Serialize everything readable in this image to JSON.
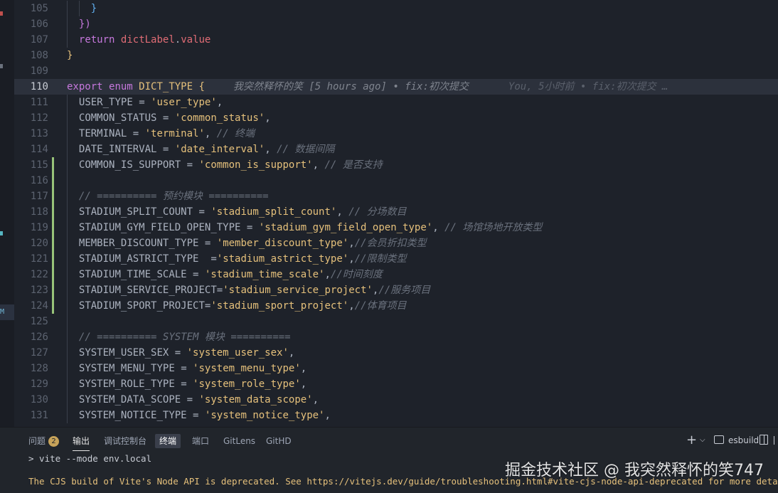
{
  "editor": {
    "lines": [
      {
        "n": "105",
        "indent": 4,
        "tokens": [
          [
            "}",
            "t-br3"
          ]
        ]
      },
      {
        "n": "106",
        "indent": 2,
        "tokens": [
          [
            "})",
            "t-br2"
          ]
        ]
      },
      {
        "n": "107",
        "indent": 2,
        "tokens": [
          [
            "return ",
            "t-kw"
          ],
          [
            "dictLabel",
            "t-prop"
          ],
          [
            ".",
            "t-plain"
          ],
          [
            "value",
            "t-prop"
          ]
        ]
      },
      {
        "n": "108",
        "indent": 0,
        "tokens": [
          [
            "}",
            "t-br1"
          ]
        ]
      },
      {
        "n": "109",
        "indent": 0,
        "tokens": []
      },
      {
        "n": "110",
        "indent": 0,
        "active": true,
        "tokens": [
          [
            "export ",
            "t-kw"
          ],
          [
            "enum ",
            "t-kw"
          ],
          [
            "DICT_TYPE ",
            "t-type"
          ],
          [
            "{",
            "t-br1"
          ]
        ],
        "blame": "我突然释怀的笑 [5 hours ago] • fix:初次提交",
        "blame2": "You, 5小时前 • fix:初次提交 …"
      },
      {
        "n": "111",
        "indent": 2,
        "tokens": [
          [
            "USER_TYPE ",
            "t-plain"
          ],
          [
            "= ",
            "t-plain"
          ],
          [
            "'user_type'",
            "t-str-y"
          ],
          [
            ",",
            "t-plain"
          ]
        ]
      },
      {
        "n": "112",
        "indent": 2,
        "tokens": [
          [
            "COMMON_STATUS ",
            "t-plain"
          ],
          [
            "= ",
            "t-plain"
          ],
          [
            "'common_status'",
            "t-str-y"
          ],
          [
            ",",
            "t-plain"
          ]
        ]
      },
      {
        "n": "113",
        "indent": 2,
        "tokens": [
          [
            "TERMINAL ",
            "t-plain"
          ],
          [
            "= ",
            "t-plain"
          ],
          [
            "'terminal'",
            "t-str-y"
          ],
          [
            ", ",
            "t-plain"
          ],
          [
            "// 终端",
            "t-cm"
          ]
        ]
      },
      {
        "n": "114",
        "indent": 2,
        "tokens": [
          [
            "DATE_INTERVAL ",
            "t-plain"
          ],
          [
            "= ",
            "t-plain"
          ],
          [
            "'date_interval'",
            "t-str-y"
          ],
          [
            ", ",
            "t-plain"
          ],
          [
            "// 数据间隔",
            "t-cm"
          ]
        ]
      },
      {
        "n": "115",
        "indent": 2,
        "mod": true,
        "tokens": [
          [
            "COMMON_IS_SUPPORT ",
            "t-plain"
          ],
          [
            "= ",
            "t-plain"
          ],
          [
            "'common_is_support'",
            "t-str-y"
          ],
          [
            ", ",
            "t-plain"
          ],
          [
            "// 是否支持",
            "t-cm"
          ]
        ]
      },
      {
        "n": "116",
        "indent": 2,
        "mod": true,
        "tokens": []
      },
      {
        "n": "117",
        "indent": 2,
        "mod": true,
        "tokens": [
          [
            "// ========== 预约模块 ==========",
            "t-cm"
          ]
        ]
      },
      {
        "n": "118",
        "indent": 2,
        "mod": true,
        "tokens": [
          [
            "STADIUM_SPLIT_COUNT ",
            "t-plain"
          ],
          [
            "= ",
            "t-plain"
          ],
          [
            "'stadium_split_count'",
            "t-str-y"
          ],
          [
            ", ",
            "t-plain"
          ],
          [
            "// 分场数目",
            "t-cm"
          ]
        ]
      },
      {
        "n": "119",
        "indent": 2,
        "mod": true,
        "tokens": [
          [
            "STADIUM_GYM_FIELD_OPEN_TYPE ",
            "t-plain"
          ],
          [
            "= ",
            "t-plain"
          ],
          [
            "'stadium_gym_field_open_type'",
            "t-str-y"
          ],
          [
            ", ",
            "t-plain"
          ],
          [
            "// 场馆场地开放类型",
            "t-cm"
          ]
        ]
      },
      {
        "n": "120",
        "indent": 2,
        "mod": true,
        "tokens": [
          [
            "MEMBER_DISCOUNT_TYPE ",
            "t-plain"
          ],
          [
            "= ",
            "t-plain"
          ],
          [
            "'member_discount_type'",
            "t-str-y"
          ],
          [
            ",",
            "t-plain"
          ],
          [
            "//会员折扣类型",
            "t-cm"
          ]
        ]
      },
      {
        "n": "121",
        "indent": 2,
        "mod": true,
        "tokens": [
          [
            "STADIUM_ASTRICT_TYPE  ",
            "t-plain"
          ],
          [
            "=",
            "t-plain"
          ],
          [
            "'stadium_astrict_type'",
            "t-str-y"
          ],
          [
            ",",
            "t-plain"
          ],
          [
            "//限制类型",
            "t-cm"
          ]
        ]
      },
      {
        "n": "122",
        "indent": 2,
        "mod": true,
        "tokens": [
          [
            "STADIUM_TIME_SCALE ",
            "t-plain"
          ],
          [
            "= ",
            "t-plain"
          ],
          [
            "'stadium_time_scale'",
            "t-str-y"
          ],
          [
            ",",
            "t-plain"
          ],
          [
            "//时间刻度",
            "t-cm"
          ]
        ]
      },
      {
        "n": "123",
        "indent": 2,
        "mod": true,
        "tokens": [
          [
            "STADIUM_SERVICE_PROJECT",
            "t-plain"
          ],
          [
            "=",
            "t-plain"
          ],
          [
            "'stadium_service_project'",
            "t-str-y"
          ],
          [
            ",",
            "t-plain"
          ],
          [
            "//服务项目",
            "t-cm"
          ]
        ]
      },
      {
        "n": "124",
        "indent": 2,
        "mod": true,
        "tokens": [
          [
            "STADIUM_SPORT_PROJECT",
            "t-plain"
          ],
          [
            "=",
            "t-plain"
          ],
          [
            "'stadium_sport_project'",
            "t-str-y"
          ],
          [
            ",",
            "t-plain"
          ],
          [
            "//体育项目",
            "t-cm"
          ]
        ]
      },
      {
        "n": "125",
        "indent": 2,
        "tokens": []
      },
      {
        "n": "126",
        "indent": 2,
        "tokens": [
          [
            "// ========== SYSTEM 模块 ==========",
            "t-cm"
          ]
        ]
      },
      {
        "n": "127",
        "indent": 2,
        "tokens": [
          [
            "SYSTEM_USER_SEX ",
            "t-plain"
          ],
          [
            "= ",
            "t-plain"
          ],
          [
            "'system_user_sex'",
            "t-str-y"
          ],
          [
            ",",
            "t-plain"
          ]
        ]
      },
      {
        "n": "128",
        "indent": 2,
        "tokens": [
          [
            "SYSTEM_MENU_TYPE ",
            "t-plain"
          ],
          [
            "= ",
            "t-plain"
          ],
          [
            "'system_menu_type'",
            "t-str-y"
          ],
          [
            ",",
            "t-plain"
          ]
        ]
      },
      {
        "n": "129",
        "indent": 2,
        "tokens": [
          [
            "SYSTEM_ROLE_TYPE ",
            "t-plain"
          ],
          [
            "= ",
            "t-plain"
          ],
          [
            "'system_role_type'",
            "t-str-y"
          ],
          [
            ",",
            "t-plain"
          ]
        ]
      },
      {
        "n": "130",
        "indent": 2,
        "tokens": [
          [
            "SYSTEM_DATA_SCOPE ",
            "t-plain"
          ],
          [
            "= ",
            "t-plain"
          ],
          [
            "'system_data_scope'",
            "t-str-y"
          ],
          [
            ",",
            "t-plain"
          ]
        ]
      },
      {
        "n": "131",
        "indent": 2,
        "tokens": [
          [
            "SYSTEM_NOTICE_TYPE ",
            "t-plain"
          ],
          [
            "= ",
            "t-plain"
          ],
          [
            "'system_notice_type'",
            "t-str-y"
          ],
          [
            ",",
            "t-plain"
          ]
        ]
      }
    ]
  },
  "panel": {
    "tabs": {
      "problems": "问题",
      "problems_count": "2",
      "output": "输出",
      "debug_console": "调试控制台",
      "terminal": "终端",
      "ports": "端口",
      "gitlens": "GitLens",
      "githd": "GitHD"
    },
    "toolbar": {
      "add": "+",
      "dropdown": "⌵",
      "terminal_name": "esbuild"
    },
    "terminal": {
      "command": "> vite --mode env.local",
      "warning": "The CJS build of Vite's Node API is deprecated. See https://vitejs.dev/guide/troubleshooting.html#vite-cjs-node-api-deprecated for more details."
    }
  },
  "left_strip": {
    "marker": "M"
  },
  "watermark": "掘金技术社区 @ 我突然释怀的笑747",
  "colors": {
    "editor_bg": "#1e222a",
    "keyword": "#c678dd",
    "string": "#e5c07b",
    "comment": "#6a717d",
    "git_modified": "#98c379"
  }
}
